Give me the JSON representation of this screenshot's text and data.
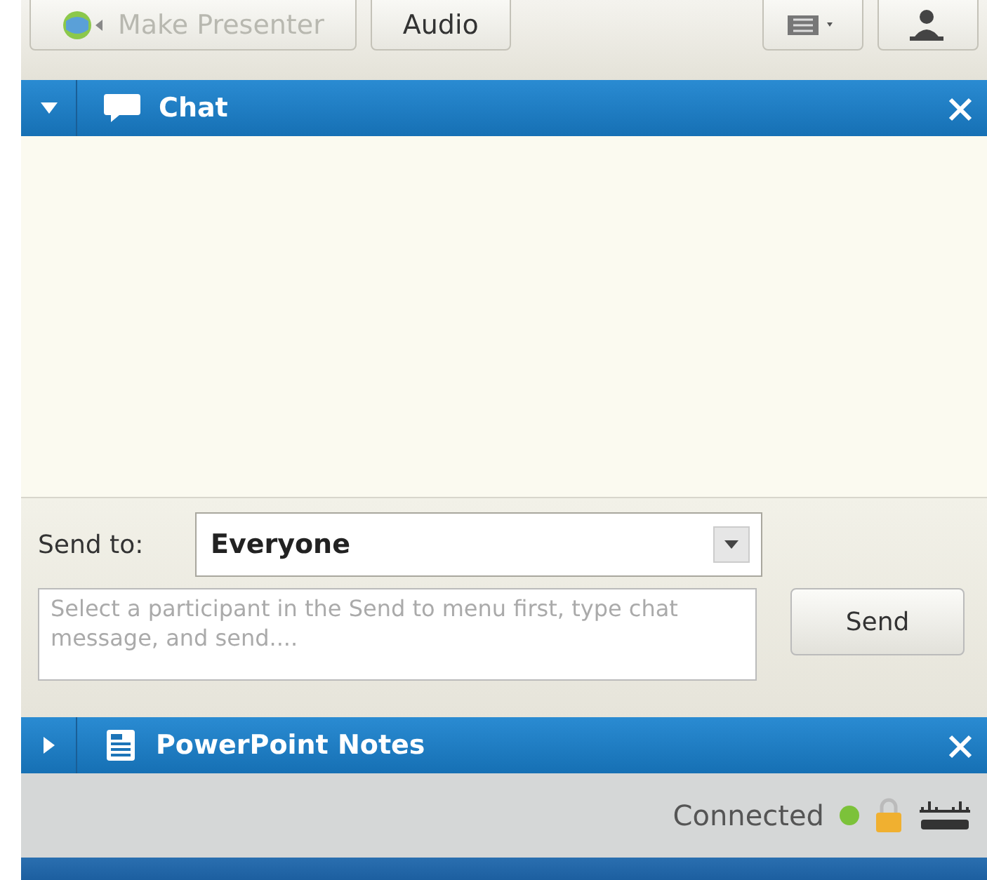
{
  "toolbar": {
    "buttons": [
      {
        "kind": "presenter",
        "label": "Make Presenter",
        "disabled": true
      },
      {
        "kind": "text",
        "label": "Audio",
        "disabled": false
      }
    ],
    "right_buttons": [
      {
        "kind": "layout"
      },
      {
        "kind": "person"
      }
    ]
  },
  "panels": [
    {
      "kind": "chat",
      "title": "Chat",
      "expanded": true
    },
    {
      "kind": "notes",
      "title": "PowerPoint Notes",
      "expanded": false
    }
  ],
  "chat": {
    "send_to_label": "Send to:",
    "send_to_value": "Everyone",
    "message_placeholder": "Select a participant in the Send to menu first, type chat message, and send....",
    "send_button": "Send"
  },
  "status_bar": {
    "text": "Connected",
    "connected": true
  }
}
